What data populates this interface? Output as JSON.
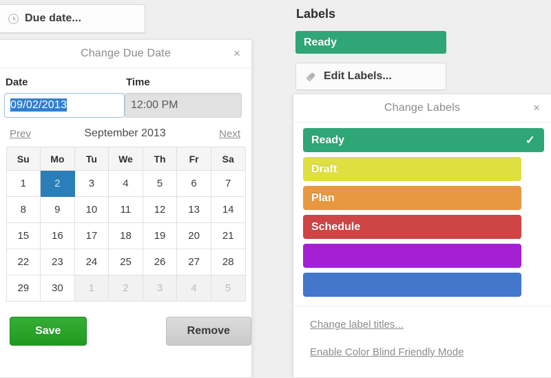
{
  "due_date_button": {
    "label": "Due date...",
    "icon": "clock-icon"
  },
  "due_popover": {
    "title": "Change Due Date",
    "close_label": "×",
    "date_field": {
      "label": "Date",
      "value": "09/02/2013"
    },
    "time_field": {
      "label": "Time",
      "value": "12:00 PM"
    },
    "calendar": {
      "prev_label": "Prev",
      "next_label": "Next",
      "month_label": "September 2013",
      "weekdays": [
        "Su",
        "Mo",
        "Tu",
        "We",
        "Th",
        "Fr",
        "Sa"
      ],
      "selected_day": 2,
      "weeks": [
        [
          {
            "d": "1",
            "o": false
          },
          {
            "d": "2",
            "o": false,
            "s": true
          },
          {
            "d": "3",
            "o": false
          },
          {
            "d": "4",
            "o": false
          },
          {
            "d": "5",
            "o": false
          },
          {
            "d": "6",
            "o": false
          },
          {
            "d": "7",
            "o": false
          }
        ],
        [
          {
            "d": "8",
            "o": false
          },
          {
            "d": "9",
            "o": false
          },
          {
            "d": "10",
            "o": false
          },
          {
            "d": "11",
            "o": false
          },
          {
            "d": "12",
            "o": false
          },
          {
            "d": "13",
            "o": false
          },
          {
            "d": "14",
            "o": false
          }
        ],
        [
          {
            "d": "15",
            "o": false
          },
          {
            "d": "16",
            "o": false
          },
          {
            "d": "17",
            "o": false
          },
          {
            "d": "18",
            "o": false
          },
          {
            "d": "19",
            "o": false
          },
          {
            "d": "20",
            "o": false
          },
          {
            "d": "21",
            "o": false
          }
        ],
        [
          {
            "d": "22",
            "o": false
          },
          {
            "d": "23",
            "o": false
          },
          {
            "d": "24",
            "o": false
          },
          {
            "d": "25",
            "o": false
          },
          {
            "d": "26",
            "o": false
          },
          {
            "d": "27",
            "o": false
          },
          {
            "d": "28",
            "o": false
          }
        ],
        [
          {
            "d": "29",
            "o": false
          },
          {
            "d": "30",
            "o": false
          },
          {
            "d": "1",
            "o": true
          },
          {
            "d": "2",
            "o": true
          },
          {
            "d": "3",
            "o": true
          },
          {
            "d": "4",
            "o": true
          },
          {
            "d": "5",
            "o": true
          }
        ]
      ]
    },
    "save_label": "Save",
    "remove_label": "Remove"
  },
  "labels_panel": {
    "heading": "Labels",
    "active_chip": {
      "text": "Ready",
      "color": "#2fa676"
    },
    "edit_button": {
      "label": "Edit Labels...",
      "icon": "tag-icon"
    }
  },
  "labels_popover": {
    "title": "Change Labels",
    "close_label": "×",
    "items": [
      {
        "text": "Ready",
        "color": "#2fa676",
        "checked": true,
        "check": "✓"
      },
      {
        "text": "Draft",
        "color": "#dfdf42",
        "checked": false,
        "check": ""
      },
      {
        "text": "Plan",
        "color": "#e89840",
        "checked": false,
        "check": ""
      },
      {
        "text": "Schedule",
        "color": "#cf4444",
        "checked": false,
        "check": ""
      },
      {
        "text": "",
        "color": "#a520d4",
        "checked": false,
        "check": ""
      },
      {
        "text": "",
        "color": "#4277cc",
        "checked": false,
        "check": ""
      }
    ],
    "change_titles_link": "Change label titles...",
    "color_blind_link": "Enable Color Blind Friendly Mode"
  }
}
